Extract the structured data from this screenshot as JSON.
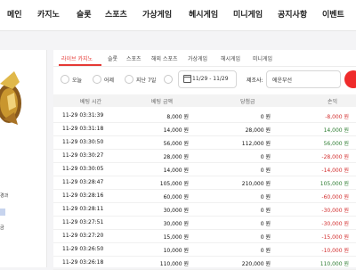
{
  "nav": {
    "items": [
      "메인",
      "카지노",
      "슬롯",
      "스포츠",
      "가상게임",
      "헤시게임",
      "미니게임",
      "공지사항",
      "이벤트"
    ]
  },
  "sidebar": {
    "text_lines": [
      "경과",
      "금"
    ]
  },
  "tabs": {
    "items": [
      "라이브 카지노",
      "슬롯",
      "스포츠",
      "해외 스포츠",
      "가상게임",
      "헤시게임",
      "미니게임"
    ],
    "active_index": 0
  },
  "filters": {
    "radios": [
      "오늘",
      "어제",
      "지난 7일"
    ],
    "date_range": "11/29 - 11/29",
    "provider_label": "제조사:",
    "provider_value": "에운부선"
  },
  "table": {
    "headers": [
      "베팅 시간",
      "베팅 금액",
      "당첨금",
      "손익"
    ],
    "rows": [
      {
        "time": "11-29 03:31:39",
        "amount": "8,000 원",
        "win": "0 원",
        "pl": "-8,000 원",
        "pl_sign": "neg"
      },
      {
        "time": "11-29 03:31:18",
        "amount": "14,000 원",
        "win": "28,000 원",
        "pl": "14,000 원",
        "pl_sign": "pos"
      },
      {
        "time": "11-29 03:30:50",
        "amount": "56,000 원",
        "win": "112,000 원",
        "pl": "56,000 원",
        "pl_sign": "pos"
      },
      {
        "time": "11-29 03:30:27",
        "amount": "28,000 원",
        "win": "0 원",
        "pl": "-28,000 원",
        "pl_sign": "neg"
      },
      {
        "time": "11-29 03:30:05",
        "amount": "14,000 원",
        "win": "0 원",
        "pl": "-14,000 원",
        "pl_sign": "neg"
      },
      {
        "time": "11-29 03:28:47",
        "amount": "105,000 원",
        "win": "210,000 원",
        "pl": "105,000 원",
        "pl_sign": "pos"
      },
      {
        "time": "11-29 03:28:16",
        "amount": "60,000 원",
        "win": "0 원",
        "pl": "-60,000 원",
        "pl_sign": "neg"
      },
      {
        "time": "11-29 03:28:11",
        "amount": "30,000 원",
        "win": "0 원",
        "pl": "-30,000 원",
        "pl_sign": "neg"
      },
      {
        "time": "11-29 03:27:51",
        "amount": "30,000 원",
        "win": "0 원",
        "pl": "-30,000 원",
        "pl_sign": "neg"
      },
      {
        "time": "11-29 03:27:20",
        "amount": "15,000 원",
        "win": "0 원",
        "pl": "-15,000 원",
        "pl_sign": "neg"
      },
      {
        "time": "11-29 03:26:50",
        "amount": "10,000 원",
        "win": "0 원",
        "pl": "-10,000 원",
        "pl_sign": "neg"
      },
      {
        "time": "11-29 03:26:18",
        "amount": "110,000 원",
        "win": "220,000 원",
        "pl": "110,000 원",
        "pl_sign": "pos"
      }
    ]
  },
  "colors": {
    "accent": "#e53935",
    "positive": "#2e7d32",
    "negative": "#d32f2f"
  }
}
